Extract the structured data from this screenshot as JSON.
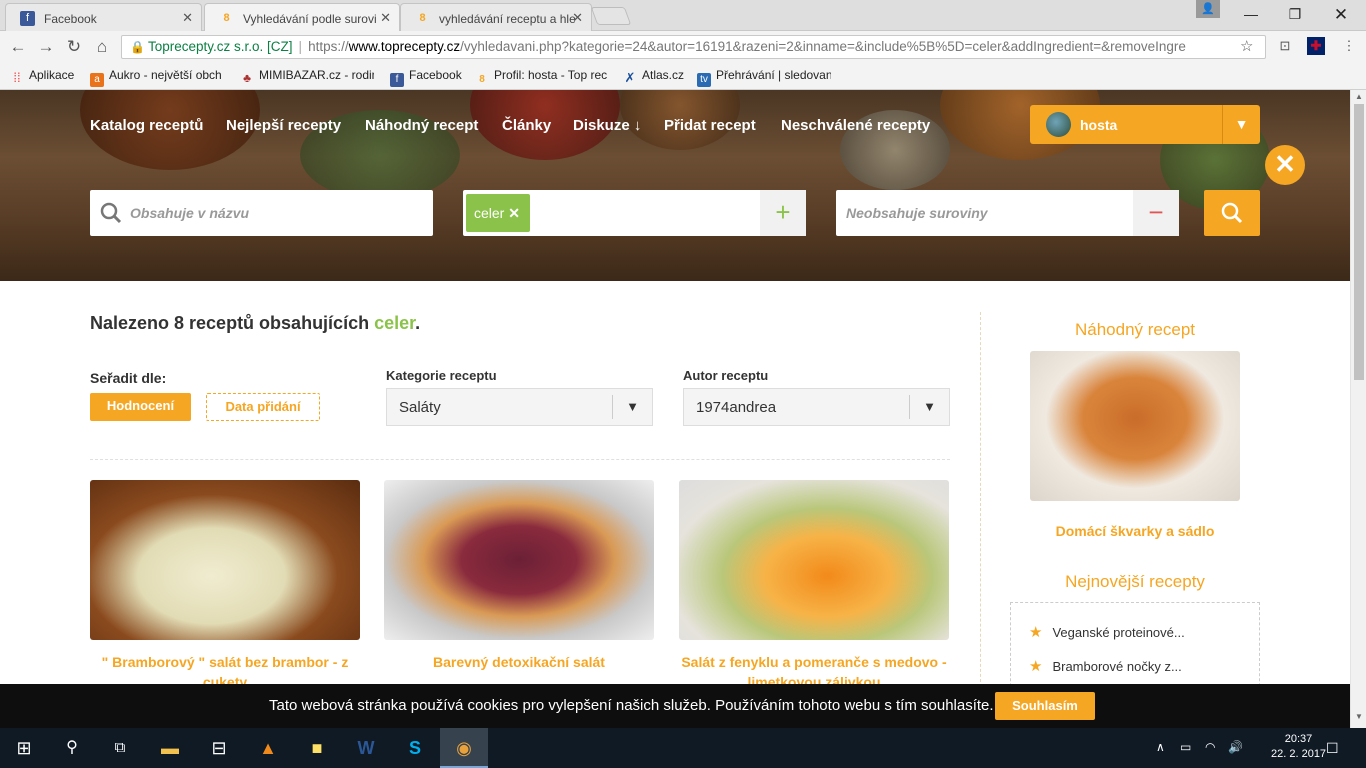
{
  "browser": {
    "tabs": [
      {
        "title": "Facebook"
      },
      {
        "title": "Vyhledávání podle surovi"
      },
      {
        "title": "vyhledávání receptu a hle"
      }
    ],
    "omnibox": {
      "security_label": "Toprecepty.cz s.r.o. [CZ]",
      "scheme": "https://",
      "host": "www.toprecepty.cz",
      "path": "/vyhledavani.php?kategorie=24&autor=16191&razeni=2&inname=&include%5B%5D=celer&addIngredient=&removeIngre"
    },
    "bookmarks": [
      {
        "label": "Aplikace",
        "icon": "apps-grid-icon"
      },
      {
        "label": "Aukro - největší obch",
        "icon": "aukro-icon"
      },
      {
        "label": "MIMIBAZAR.cz - rodin",
        "icon": "mimibazar-icon"
      },
      {
        "label": "Facebook",
        "icon": "facebook-icon"
      },
      {
        "label": "Profil: hosta - Top rec",
        "icon": "toprecepty-icon"
      },
      {
        "label": "Atlas.cz",
        "icon": "atlas-icon"
      },
      {
        "label": "Přehrávání | sledovani",
        "icon": "tv-icon"
      }
    ]
  },
  "site": {
    "nav": [
      "Katalog receptů",
      "Nejlepší recepty",
      "Náhodný recept",
      "Články",
      "Diskuze ↓",
      "Přidat recept",
      "Neschválené recepty"
    ],
    "user": {
      "name": "hosta"
    },
    "search": {
      "name_placeholder": "Obsahuje v názvu",
      "include_chip": "celer",
      "exclude_placeholder": "Neobsahuje suroviny"
    }
  },
  "results": {
    "found_prefix": "Nalezeno 8 receptů obsahujících ",
    "found_term": "celer",
    "found_suffix": ".",
    "sort_label": "Seřadit dle:",
    "sort_rating": "Hodnocení",
    "sort_date": "Data přidání",
    "category_label": "Kategorie receptu",
    "category_value": "Saláty",
    "author_label": "Autor receptu",
    "author_value": "1974andrea",
    "recipes": [
      {
        "title": "\" Bramborový \" salát bez brambor - z cukety"
      },
      {
        "title": "Barevný detoxikační salát"
      },
      {
        "title": "Salát z fenyklu a pomeranče s medovo - limetkovou zálivkou"
      }
    ]
  },
  "sidebar": {
    "random_heading": "Náhodný recept",
    "random_title": "Domácí škvarky a sádlo",
    "newest_heading": "Nejnovější recepty",
    "newest": [
      "Veganské proteinové...",
      "Bramborové nočky z..."
    ]
  },
  "cookie": {
    "text": "Tato webová stránka používá cookies pro vylepšení našich služeb. Používáním tohoto webu s tím souhlasíte.",
    "accept": "Souhlasím"
  },
  "taskbar": {
    "time": "20:37",
    "date": "22. 2. 2017"
  },
  "colors": {
    "accent": "#f5a623",
    "green": "#8bc34a",
    "dark": "#0e0e0e"
  }
}
